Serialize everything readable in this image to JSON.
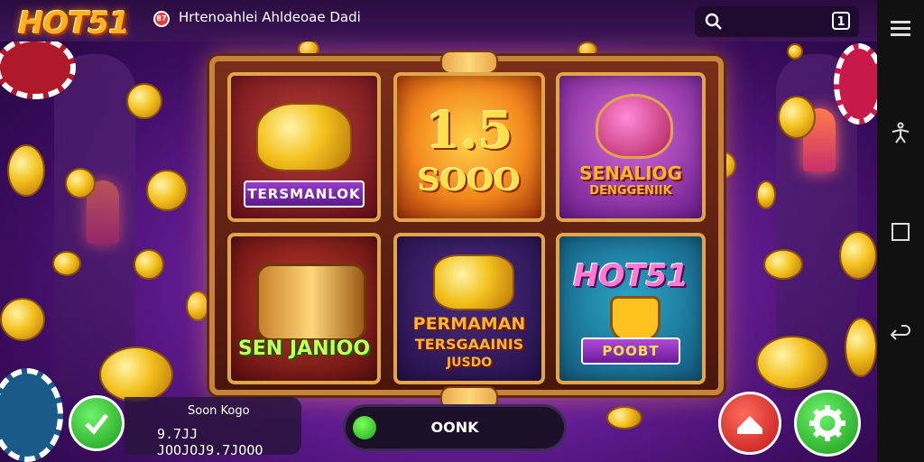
{
  "app": {
    "logo": "HOT51",
    "tab_badge": "87",
    "tab_title": "Hrtenoahlei Ahldeoae Dadi"
  },
  "browser": {
    "tabs_label": "1"
  },
  "tiles": [
    {
      "label": "TERSMANLOK"
    },
    {
      "big": "1.5",
      "sub": "SOOO"
    },
    {
      "line1": "SENALIOG",
      "line2": "DENGGENIIK"
    },
    {
      "label": "SEN JANIOO"
    },
    {
      "line1": "PERMAMAN",
      "line2": "TERSGAAINIS",
      "line3": "JUSDO"
    },
    {
      "logo": "HOT51",
      "label": "POOBT"
    }
  ],
  "controls": {
    "balance_title": "Soon Kogo",
    "balance_value": "9.7JJ JOOJOJ9.7JOOO",
    "status_text": "OONK"
  },
  "colors": {
    "accent": "#ffb21c",
    "frame": "#c9823a",
    "green": "#1c9a1a",
    "red": "#c0161a"
  },
  "icons": [
    "search-icon",
    "tabs-icon",
    "menu-icon",
    "accessibility-icon",
    "overview-icon",
    "back-icon",
    "check-icon",
    "home-icon",
    "gear-icon"
  ]
}
